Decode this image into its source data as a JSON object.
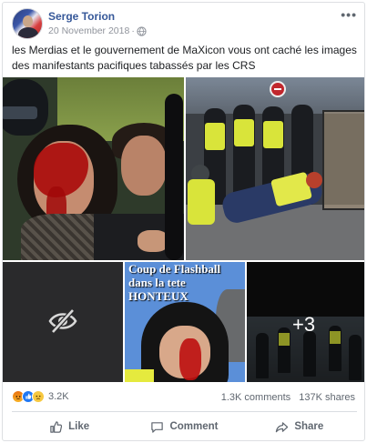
{
  "post": {
    "author": "Serge Torion",
    "date": "20 November 2018",
    "date_separator": "·",
    "more_label": "•••",
    "text": "les Merdias et le gouvernement de MaXicon vous ont caché les images des manifestants pacifiques tabassés par les CRS"
  },
  "icons": {
    "privacy": "globe-icon",
    "hidden_photo": "eye-slash-icon",
    "reactions": [
      "angry-reaction-icon",
      "like-reaction-icon",
      "sad-reaction-icon"
    ],
    "like": "thumbs-up-icon",
    "comment": "speech-bubble-icon",
    "share": "share-arrow-icon"
  },
  "photos": {
    "caption_4": "Coup de Flashball dans la tete HONTEUX",
    "more_count": "+3"
  },
  "engagement": {
    "reactions_count": "3.2K",
    "comments": "1.3K comments",
    "shares": "137K shares"
  },
  "actions": {
    "like": "Like",
    "comment": "Comment",
    "share": "Share"
  },
  "colors": {
    "author_link": "#365899",
    "secondary_text": "#606770",
    "like_blue": "#2078f4"
  }
}
